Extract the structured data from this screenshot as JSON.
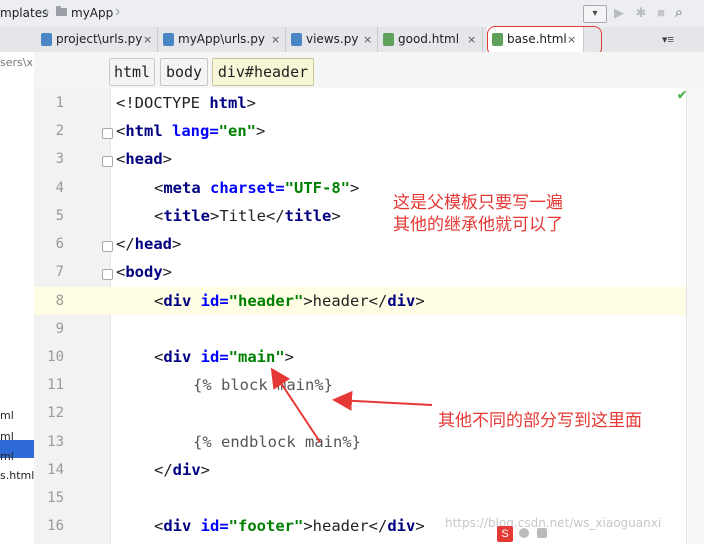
{
  "breadcrumb": {
    "part1": "mplates",
    "part2": "myApp"
  },
  "tabs": [
    {
      "label": "project\\urls.py",
      "close": "×"
    },
    {
      "label": "myApp\\urls.py",
      "close": "×"
    },
    {
      "label": "views.py",
      "close": "×"
    },
    {
      "label": "good.html",
      "close": "×"
    },
    {
      "label": "base.html",
      "close": "×"
    }
  ],
  "sidebar": {
    "minus": "-",
    "path": "sers\\x",
    "items": [
      "ml",
      "ml",
      "ml",
      "s.html"
    ]
  },
  "tag_path": [
    "html",
    "body",
    "div#header"
  ],
  "line_numbers": [
    "1",
    "2",
    "3",
    "4",
    "5",
    "6",
    "7",
    "8",
    "9",
    "10",
    "11",
    "12",
    "13",
    "14",
    "15",
    "16"
  ],
  "code": {
    "l1_text": "<!DOCTYPE ",
    "l1_tag": "html",
    "l1_end": ">",
    "l2_open": "<",
    "l2_tag": "html",
    "l2_attr": " lang=",
    "l2_val": "\"en\"",
    "l2_end": ">",
    "l3_open": "<",
    "l3_tag": "head",
    "l3_end": ">",
    "l4_open": "<",
    "l4_tag": "meta",
    "l4_attr": " charset=",
    "l4_val": "\"UTF-8\"",
    "l4_end": ">",
    "l5_open": "<",
    "l5_tag": "title",
    "l5_mid": ">Title</",
    "l5_tag2": "title",
    "l5_end": ">",
    "l6_open": "</",
    "l6_tag": "head",
    "l6_end": ">",
    "l7_open": "<",
    "l7_tag": "body",
    "l7_end": ">",
    "l8_open": "<",
    "l8_tag": "div",
    "l8_attr": " id=",
    "l8_val": "\"header\"",
    "l8_mid": ">header</",
    "l8_tag2": "div",
    "l8_end": ">",
    "l10_open": "<",
    "l10_tag": "div",
    "l10_attr": " id=",
    "l10_val": "\"main\"",
    "l10_end": ">",
    "l11": "{% block main%}",
    "l13": "{% endblock main%}",
    "l14_open": "</",
    "l14_tag": "div",
    "l14_end": ">",
    "l16_open": "<",
    "l16_tag": "div",
    "l16_attr": " id=",
    "l16_val": "\"footer\"",
    "l16_mid": ">header</",
    "l16_tag2": "div",
    "l16_end": ">"
  },
  "annotations": {
    "note_top_line1": "这是父模板只要写一遍",
    "note_top_line2": "其他的继承他就可以了",
    "note_middle": "其他不同的部分写到这里面"
  },
  "watermark": "https://blog.csdn.net/ws_xiaoguanxi",
  "colors": {
    "annotation_red": "#e53935",
    "tag_blue": "#000080",
    "attr_blue": "#0000ff",
    "value_green": "#008000",
    "current_line": "#fffde3"
  }
}
